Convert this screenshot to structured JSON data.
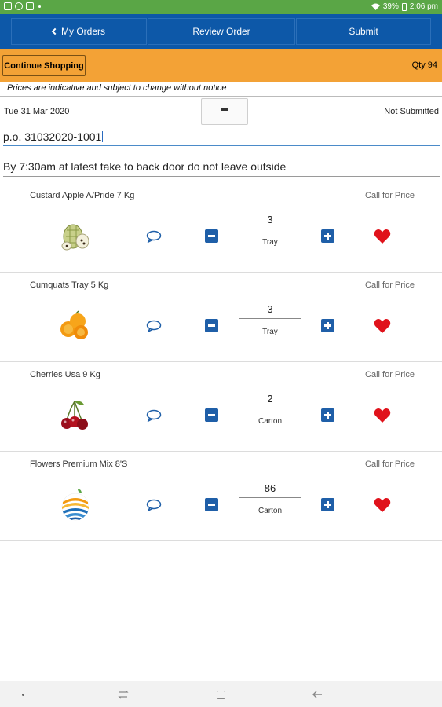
{
  "status_bar": {
    "battery": "39%",
    "time": "2:06 pm"
  },
  "nav": {
    "back_label": "My Orders",
    "review_label": "Review Order",
    "submit_label": "Submit"
  },
  "toolbar": {
    "continue_label": "Continue Shopping",
    "qty_label": "Qty 94"
  },
  "disclaimer": "Prices are indicative and subject to change without notice",
  "order": {
    "date": "Tue 31 Mar 2020",
    "status": "Not Submitted",
    "po_number": "p.o. 31032020-1001",
    "notes": "By 7:30am at latest take to back door do not leave outside"
  },
  "products": [
    {
      "name": "Custard Apple A/Pride 7 Kg",
      "price": "Call for Price",
      "qty": "3",
      "unit": "Tray",
      "image": "custard-apple"
    },
    {
      "name": "Cumquats Tray 5 Kg",
      "price": "Call for Price",
      "qty": "3",
      "unit": "Tray",
      "image": "cumquats"
    },
    {
      "name": "Cherries Usa 9 Kg",
      "price": "Call for Price",
      "qty": "2",
      "unit": "Carton",
      "image": "cherries"
    },
    {
      "name": "Flowers Premium Mix 8'S",
      "price": "Call for Price",
      "qty": "86",
      "unit": "Carton",
      "image": "flowers-logo"
    }
  ],
  "colors": {
    "status_bar": "#5aa646",
    "nav_bar": "#0d58a8",
    "toolbar": "#f3a236",
    "button_blue": "#1f5fa8",
    "heart_red": "#e0121b"
  }
}
